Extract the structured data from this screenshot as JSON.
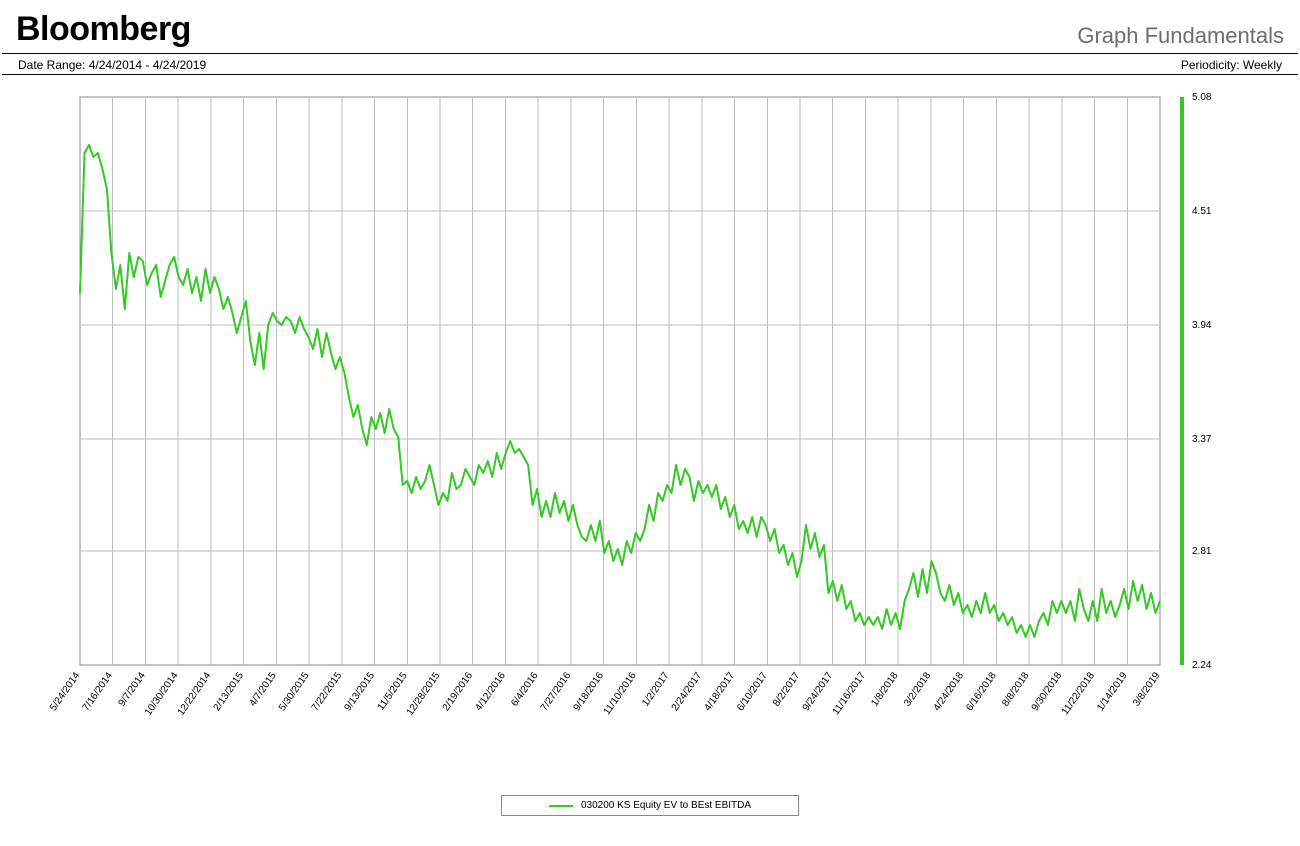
{
  "header": {
    "logo": "Bloomberg",
    "subtitle": "Graph Fundamentals"
  },
  "meta": {
    "date_range": "Date Range: 4/24/2014 - 4/24/2019",
    "periodicity": "Periodicity: Weekly"
  },
  "legend": {
    "series_name": "030200 KS Equity EV to BEst EBITDA",
    "color": "#34c924"
  },
  "chart_data": {
    "type": "line",
    "title": "",
    "xlabel": "",
    "ylabel": "",
    "ylim": [
      2.24,
      5.08
    ],
    "y_ticks": [
      2.24,
      2.81,
      3.37,
      3.94,
      4.51,
      5.08
    ],
    "x_tick_labels": [
      "5/24/2014",
      "7/16/2014",
      "9/7/2014",
      "10/30/2014",
      "12/22/2014",
      "2/13/2015",
      "4/7/2015",
      "5/30/2015",
      "7/22/2015",
      "9/13/2015",
      "11/5/2015",
      "12/28/2015",
      "2/19/2016",
      "4/12/2016",
      "6/4/2016",
      "7/27/2016",
      "9/18/2016",
      "11/10/2016",
      "1/2/2017",
      "2/24/2017",
      "4/18/2017",
      "6/10/2017",
      "8/2/2017",
      "9/24/2017",
      "11/16/2017",
      "1/8/2018",
      "3/2/2018",
      "4/24/2018",
      "6/16/2018",
      "8/8/2018",
      "9/30/2018",
      "11/22/2018",
      "1/14/2019",
      "3/8/2019"
    ],
    "series": [
      {
        "name": "030200 KS Equity EV to BEst EBITDA",
        "color": "#34c924",
        "values": [
          4.1,
          4.8,
          4.84,
          4.78,
          4.8,
          4.72,
          4.62,
          4.3,
          4.12,
          4.24,
          4.02,
          4.3,
          4.18,
          4.28,
          4.26,
          4.14,
          4.2,
          4.24,
          4.08,
          4.16,
          4.24,
          4.28,
          4.18,
          4.14,
          4.22,
          4.1,
          4.18,
          4.06,
          4.22,
          4.1,
          4.18,
          4.12,
          4.02,
          4.08,
          4.0,
          3.9,
          3.98,
          4.06,
          3.86,
          3.74,
          3.9,
          3.72,
          3.94,
          4.0,
          3.96,
          3.94,
          3.98,
          3.96,
          3.9,
          3.98,
          3.92,
          3.88,
          3.82,
          3.92,
          3.78,
          3.9,
          3.8,
          3.72,
          3.78,
          3.7,
          3.58,
          3.48,
          3.54,
          3.42,
          3.34,
          3.48,
          3.42,
          3.5,
          3.4,
          3.52,
          3.42,
          3.38,
          3.14,
          3.16,
          3.1,
          3.18,
          3.12,
          3.16,
          3.24,
          3.14,
          3.04,
          3.1,
          3.06,
          3.2,
          3.12,
          3.14,
          3.22,
          3.18,
          3.14,
          3.24,
          3.2,
          3.26,
          3.18,
          3.3,
          3.22,
          3.3,
          3.36,
          3.3,
          3.32,
          3.28,
          3.24,
          3.04,
          3.12,
          2.98,
          3.06,
          2.98,
          3.1,
          3.0,
          3.06,
          2.96,
          3.04,
          2.94,
          2.88,
          2.86,
          2.94,
          2.86,
          2.96,
          2.8,
          2.86,
          2.76,
          2.82,
          2.74,
          2.86,
          2.8,
          2.9,
          2.86,
          2.92,
          3.04,
          2.96,
          3.1,
          3.06,
          3.14,
          3.1,
          3.24,
          3.14,
          3.22,
          3.18,
          3.06,
          3.16,
          3.1,
          3.14,
          3.08,
          3.14,
          3.02,
          3.08,
          2.98,
          3.04,
          2.92,
          2.96,
          2.9,
          2.98,
          2.88,
          2.98,
          2.94,
          2.86,
          2.92,
          2.8,
          2.84,
          2.74,
          2.8,
          2.68,
          2.76,
          2.94,
          2.82,
          2.9,
          2.78,
          2.84,
          2.6,
          2.66,
          2.56,
          2.64,
          2.52,
          2.56,
          2.46,
          2.5,
          2.44,
          2.48,
          2.44,
          2.48,
          2.42,
          2.52,
          2.44,
          2.5,
          2.42,
          2.56,
          2.62,
          2.7,
          2.58,
          2.72,
          2.6,
          2.76,
          2.7,
          2.6,
          2.56,
          2.64,
          2.54,
          2.6,
          2.5,
          2.54,
          2.48,
          2.56,
          2.5,
          2.6,
          2.5,
          2.54,
          2.46,
          2.5,
          2.44,
          2.48,
          2.4,
          2.44,
          2.38,
          2.44,
          2.38,
          2.46,
          2.5,
          2.44,
          2.56,
          2.5,
          2.56,
          2.5,
          2.56,
          2.46,
          2.62,
          2.52,
          2.46,
          2.56,
          2.46,
          2.62,
          2.5,
          2.56,
          2.48,
          2.54,
          2.62,
          2.52,
          2.66,
          2.56,
          2.64,
          2.52,
          2.6,
          2.5,
          2.56
        ]
      }
    ]
  }
}
